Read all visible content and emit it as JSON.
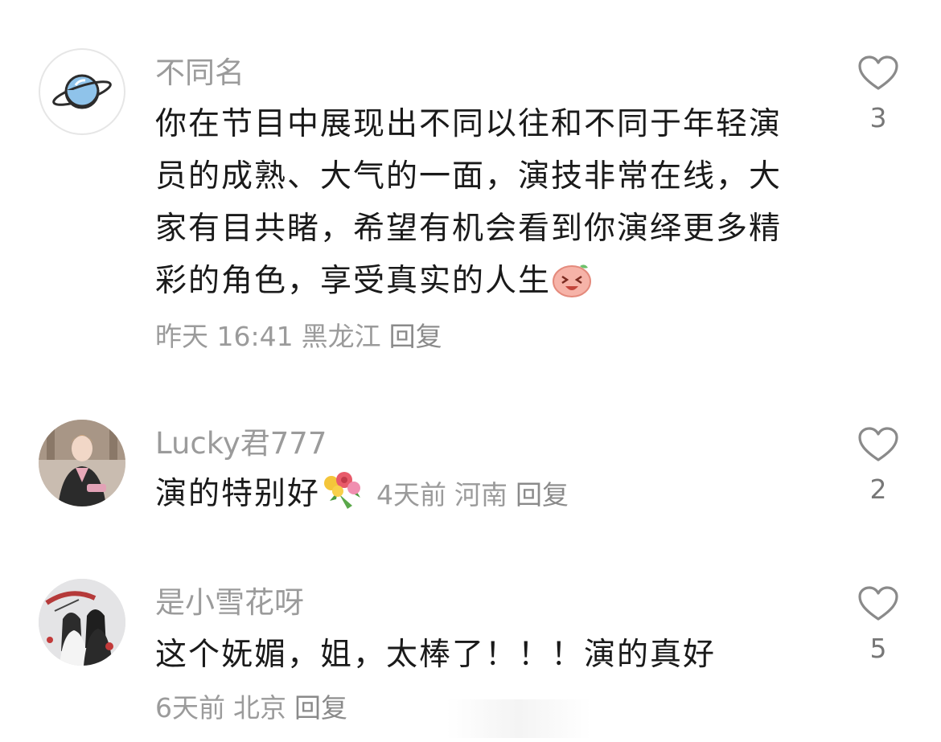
{
  "comments": [
    {
      "author": "不同名",
      "text": "你在节目中展现出不同以往和不同于年轻演员的成熟、大气的一面，演技非常在线，大家有目共睹，希望有机会看到你演绎更多精彩的角色，享受真实的人生",
      "emoji": "laughing-face-emoji",
      "time": "昨天 16:41",
      "location": "黑龙江",
      "reply_label": "回复",
      "likes": "3",
      "avatar": "planet-icon"
    },
    {
      "author": "Lucky君777",
      "text": "演的特别好",
      "emoji": "bouquet-emoji",
      "time": "4天前",
      "location": "河南",
      "reply_label": "回复",
      "likes": "2",
      "avatar": "photo-avatar"
    },
    {
      "author": "是小雪花呀",
      "text": "这个妩媚，姐，太棒了！！！演的真好",
      "time": "6天前",
      "location": "北京",
      "reply_label": "回复",
      "likes": "5",
      "avatar": "illustration-avatar"
    }
  ],
  "colors": {
    "secondary_text": "#9b9b9b",
    "body_text": "#1a1a1a",
    "heart_outline": "#8a8a8a"
  }
}
